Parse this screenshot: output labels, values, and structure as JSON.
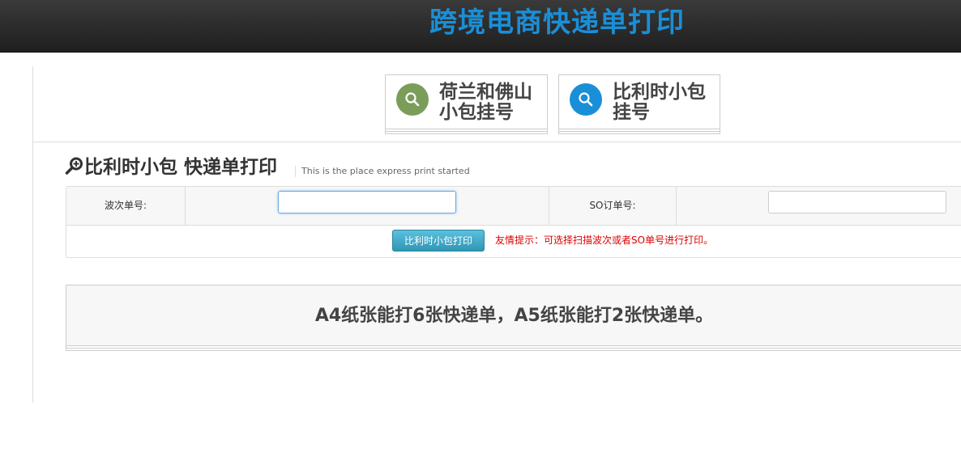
{
  "header": {
    "title": "跨境电商快递单打印"
  },
  "nav": {
    "items": [
      {
        "label_line1": "荷兰和佛山",
        "label_line2": "小包挂号",
        "icon": "search-icon",
        "color": "#7a9e5a"
      },
      {
        "label_line1": "比利时小包",
        "label_line2": "挂号",
        "icon": "search-icon",
        "color": "#1a8fd8"
      }
    ]
  },
  "page": {
    "title": "比利时小包 快递单打印",
    "title_icon": "zoom-in-icon",
    "subtitle": "This is the place express print  started"
  },
  "form": {
    "batch_label": "波次单号:",
    "batch_value": "",
    "so_label": "SO订单号:",
    "so_value": "",
    "print_button": "比利时小包打印",
    "hint": "友情提示：可选择扫描波次或者SO单号进行打印。"
  },
  "note": {
    "text": "A4纸张能打6张快递单，A5纸张能打2张快递单。"
  },
  "colors": {
    "accent": "#1a8fd8",
    "button": "#49afcd",
    "hint": "#dd0000"
  }
}
